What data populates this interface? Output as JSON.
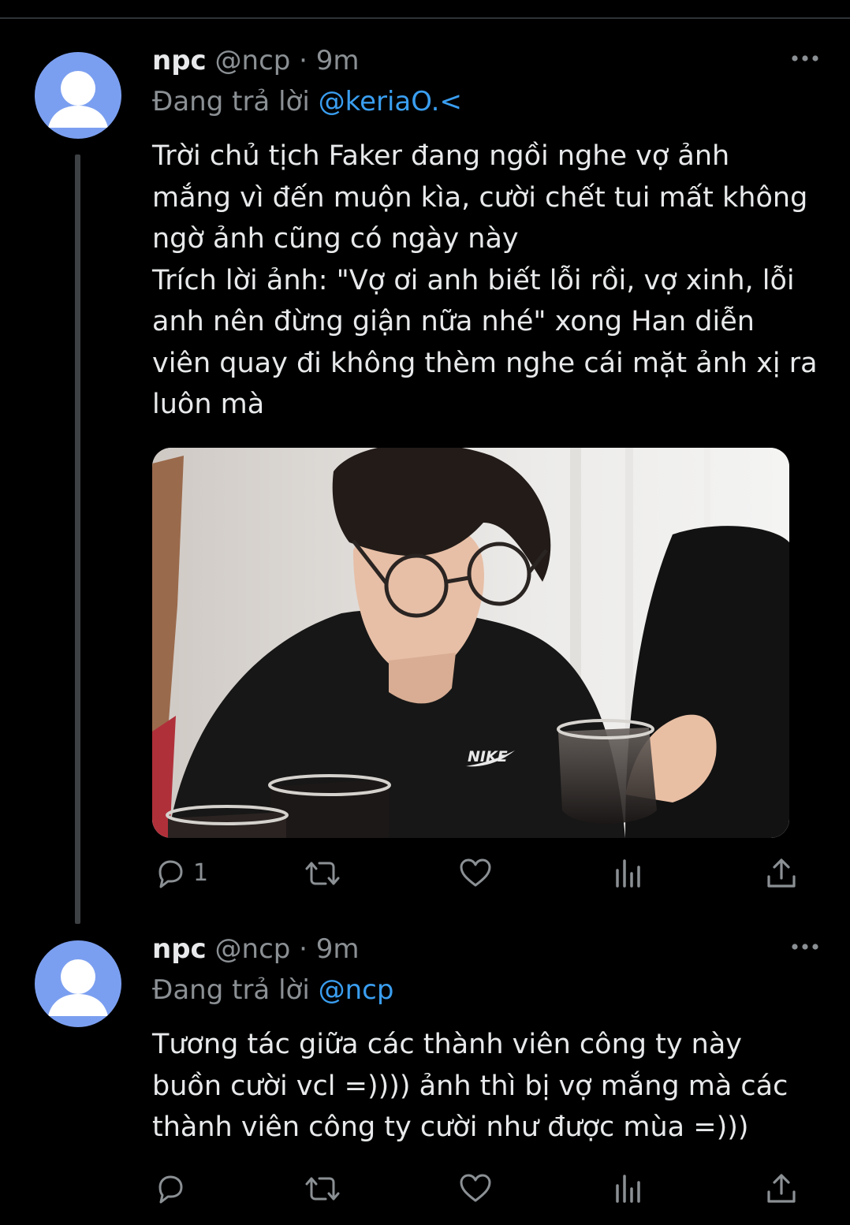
{
  "tweets": [
    {
      "display_name": "npc",
      "handle": "@ncp",
      "separator": "·",
      "time": "9m",
      "replying_prefix": "Đang trả lời",
      "replying_to": "@keriaO.<",
      "text": "Trời chủ tịch Faker đang ngồi nghe vợ ảnh\nmắng vì đến muộn kìa, cười chết tui mất không\nngờ ảnh cũng có ngày này\nTrích lời ảnh: \"Vợ ơi anh biết lỗi rồi, vợ xinh, lỗi\nanh nên đừng giận nữa nhé\" xong Han diễn\nviên quay đi không thèm nghe cái mặt ảnh xị ra\nluôn mà",
      "media_logo_text": "NIKE",
      "reply_count": "1"
    },
    {
      "display_name": "npc",
      "handle": "@ncp",
      "separator": "·",
      "time": "9m",
      "replying_prefix": "Đang trả lời",
      "replying_to": "@ncp",
      "text": "Tương tác giữa các thành viên công ty này\nbuồn cười vcl =)))) ảnh thì bị vợ mắng mà các\nthành viên công ty cười như được mùa =)))",
      "reply_count": ""
    }
  ],
  "icons": {
    "more": "more-horizontal-icon",
    "reply": "reply-bubble-icon",
    "retweet": "retweet-icon",
    "like": "heart-icon",
    "views": "analytics-bars-icon",
    "share": "share-upload-icon"
  },
  "colors": {
    "background": "#000000",
    "text": "#e7e9ea",
    "muted": "#8b9094",
    "link": "#3a9ef0",
    "avatar": "#7b9ff0",
    "thread_line": "#3e4144"
  }
}
